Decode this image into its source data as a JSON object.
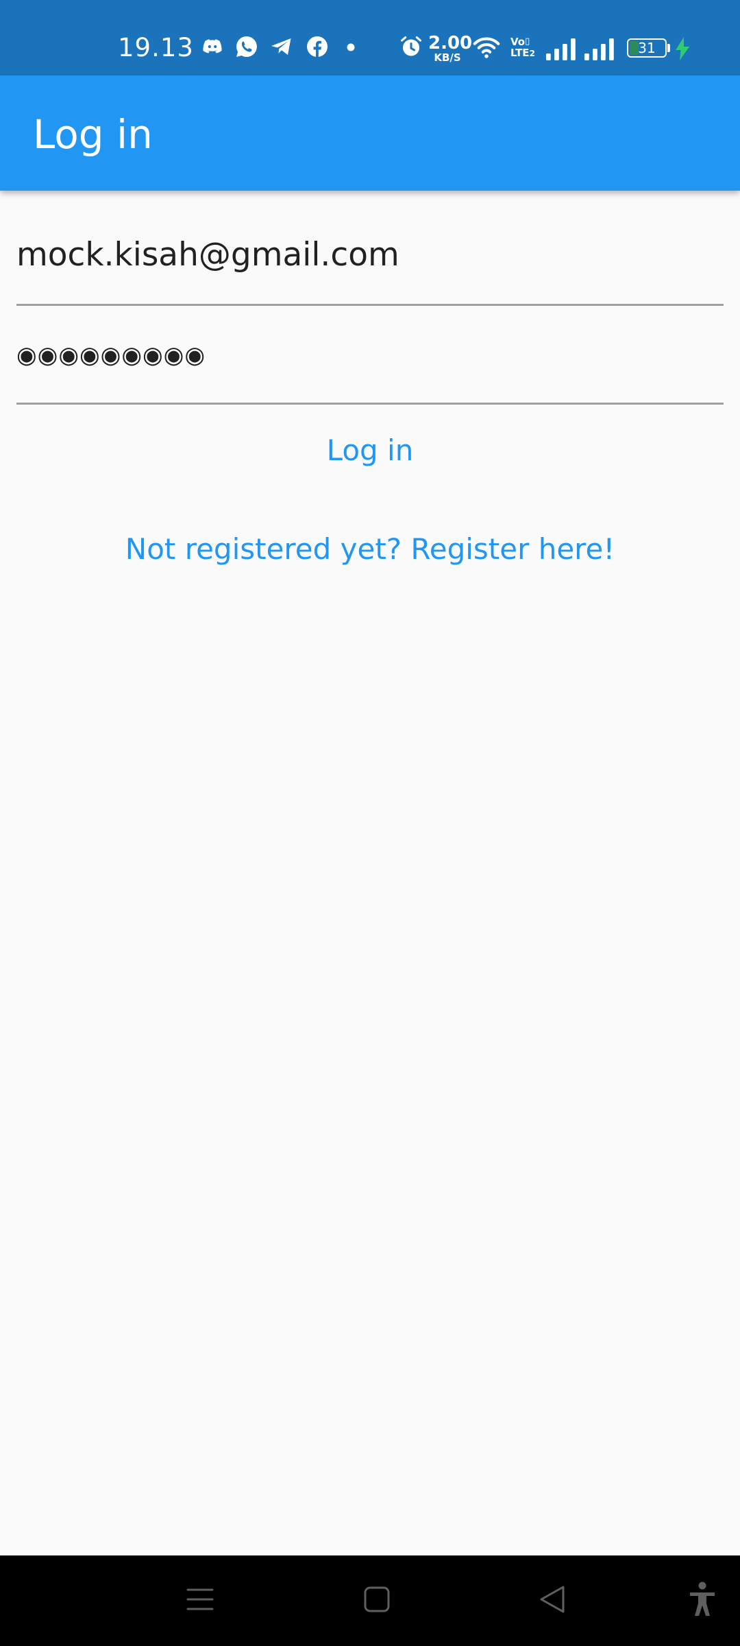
{
  "status_bar": {
    "time": "19.13",
    "notification_icons": [
      "discord-icon",
      "whatsapp-icon",
      "telegram-icon",
      "facebook-icon",
      "more-dot-icon"
    ],
    "speed_value": "2.00",
    "speed_unit": "KB/S",
    "volte_top": "Vo",
    "volte_bottom": "LTE",
    "sim_index": "2",
    "battery_level": "31",
    "charging": true,
    "colors": {
      "background": "#1b73bb",
      "battery_fill": "#2e8b57",
      "charging_bolt": "#2ecc71"
    }
  },
  "app_bar": {
    "title": "Log in",
    "color": "#2196f3"
  },
  "form": {
    "email_value": "mock.kisah@gmail.com",
    "password_value": "◉◉◉◉◉◉◉◉◉",
    "login_label": "Log in",
    "register_label": "Not registered yet? Register here!",
    "accent_color": "#2196f3"
  },
  "nav_bar": {
    "buttons": [
      "menu-icon",
      "home-icon",
      "back-icon",
      "accessibility-icon"
    ]
  }
}
